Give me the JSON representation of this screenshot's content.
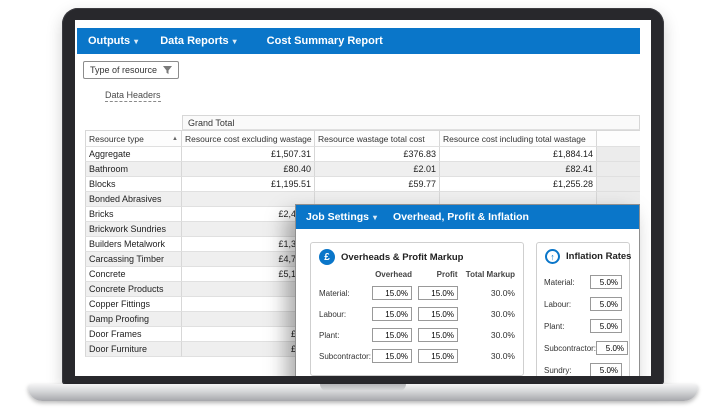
{
  "colors": {
    "accent": "#0a76c9"
  },
  "menu": {
    "items": [
      {
        "label": "Outputs"
      },
      {
        "label": "Data Reports"
      },
      {
        "label": "Cost Summary Report"
      }
    ]
  },
  "filter_chip": {
    "label": "Type of resource"
  },
  "data_headers_link": "Data Headers",
  "table": {
    "group_header": "Grand Total",
    "columns": [
      "Resource type",
      "Resource cost excluding wastage",
      "Resource wastage total cost",
      "Resource cost including total wastage"
    ],
    "rows": [
      {
        "type": "Aggregate",
        "excl": "£1,507.31",
        "wastage": "£376.83",
        "incl": "£1,884.14"
      },
      {
        "type": "Bathroom",
        "excl": "£80.40",
        "wastage": "£2.01",
        "incl": "£82.41"
      },
      {
        "type": "Blocks",
        "excl": "£1,195.51",
        "wastage": "£59.77",
        "incl": "£1,255.28"
      },
      {
        "type": "Bonded Abrasives",
        "excl": "",
        "wastage": "",
        "incl": ""
      },
      {
        "type": "Bricks",
        "excl": "£2,4",
        "wastage": "",
        "incl": "",
        "partial": true
      },
      {
        "type": "Brickwork Sundries",
        "excl": "",
        "wastage": "",
        "incl": "",
        "partial": true
      },
      {
        "type": "Builders Metalwork",
        "excl": "£1,3",
        "wastage": "",
        "incl": "",
        "partial": true
      },
      {
        "type": "Carcassing Timber",
        "excl": "£4,7",
        "wastage": "",
        "incl": "",
        "partial": true
      },
      {
        "type": "Concrete",
        "excl": "£5,1",
        "wastage": "",
        "incl": "",
        "partial": true
      },
      {
        "type": "Concrete Products",
        "excl": "",
        "wastage": "",
        "incl": "",
        "partial": true
      },
      {
        "type": "Copper Fittings",
        "excl": "",
        "wastage": "",
        "incl": "",
        "partial": true
      },
      {
        "type": "Damp Proofing",
        "excl": "",
        "wastage": "",
        "incl": "",
        "partial": true
      },
      {
        "type": "Door Frames",
        "excl": "£",
        "wastage": "",
        "incl": "",
        "partial": true
      },
      {
        "type": "Door Furniture",
        "excl": "£",
        "wastage": "",
        "incl": "",
        "partial": true
      }
    ]
  },
  "dialog": {
    "menu_label": "Job Settings",
    "title": "Overhead, Profit & Inflation",
    "markup_panel": {
      "title": "Overheads & Profit Markup",
      "columns": [
        "Overhead",
        "Profit",
        "Total Markup"
      ],
      "rows": [
        {
          "label": "Material:",
          "overhead": "15.0%",
          "profit": "15.0%",
          "total": "30.0%"
        },
        {
          "label": "Labour:",
          "overhead": "15.0%",
          "profit": "15.0%",
          "total": "30.0%"
        },
        {
          "label": "Plant:",
          "overhead": "15.0%",
          "profit": "15.0%",
          "total": "30.0%"
        },
        {
          "label": "Subcontractor:",
          "overhead": "15.0%",
          "profit": "15.0%",
          "total": "30.0%"
        }
      ]
    },
    "inflation_panel": {
      "title": "Inflation Rates",
      "rows": [
        {
          "label": "Material:",
          "value": "5.0%"
        },
        {
          "label": "Labour:",
          "value": "5.0%"
        },
        {
          "label": "Plant:",
          "value": "5.0%"
        },
        {
          "label": "Subcontractor:",
          "value": "5.0%"
        },
        {
          "label": "Sundry:",
          "value": "5.0%"
        }
      ]
    }
  }
}
